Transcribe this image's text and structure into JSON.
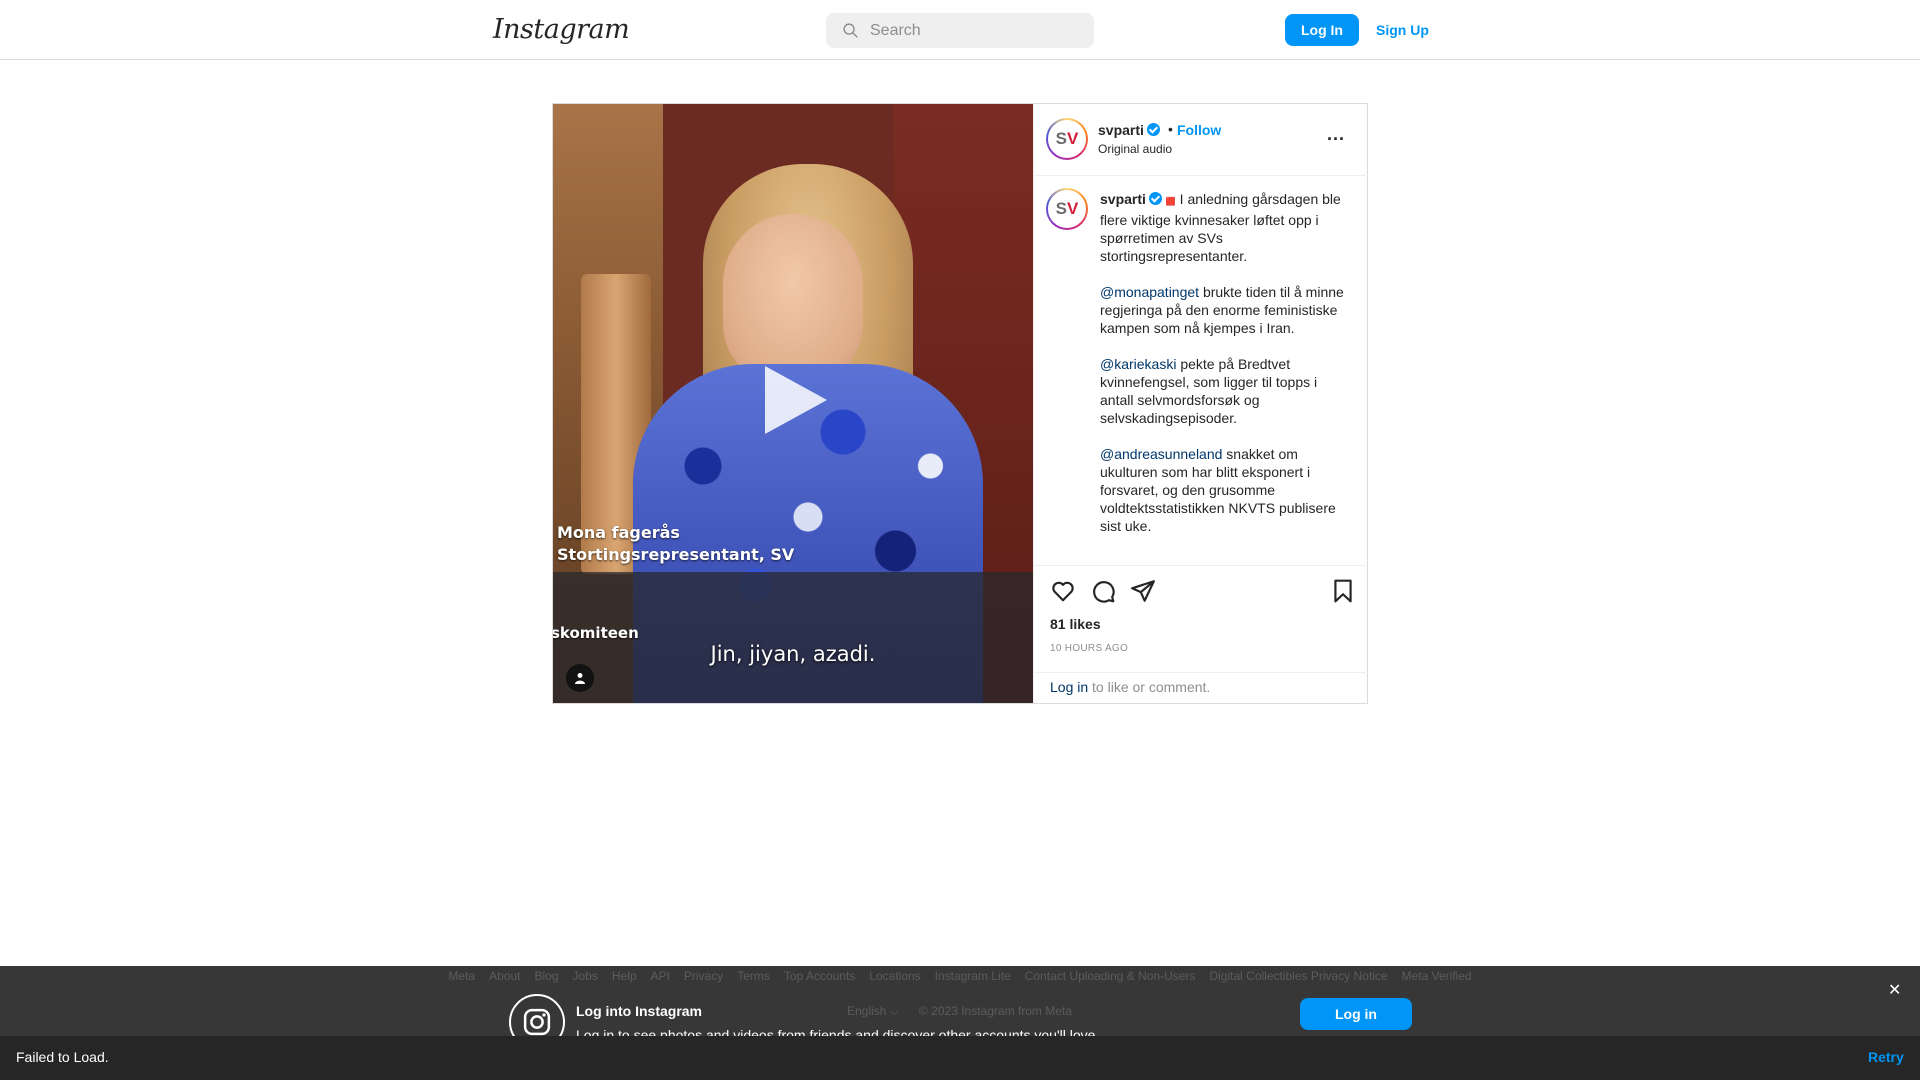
{
  "nav": {
    "logo": "Instagram",
    "search_placeholder": "Search",
    "login_label": "Log In",
    "signup_label": "Sign Up"
  },
  "post": {
    "video": {
      "name_overlay": "Mona fagerås",
      "role_overlay": "Stortingsrepresentant, SV",
      "committee_overlay": "skomiteen",
      "subtitle": "Jin, jiyan, azadi."
    },
    "header": {
      "avatar_text_s": "S",
      "avatar_text_v": "V",
      "username": "svparti",
      "separator": "•",
      "follow_label": "Follow",
      "audio_label": "Original audio",
      "more_label": "..."
    },
    "caption": {
      "username": "svparti",
      "glyph": "🟥",
      "intro": "I anledning gårsdagen ble flere viktige kvinnesaker løftet opp i spørretimen av SVs stortingsrepresentanter.",
      "p1_mention": "@monapatinget",
      "p1_text": " brukte tiden til å minne regjeringa på den enorme feministiske kampen som nå kjempes i Iran.",
      "p2_mention": "@kariekaski",
      "p2_text": " pekte på Bredtvet kvinnefengsel, som ligger til topps i antall selvmordsforsøk og selvskadingsepisoder.",
      "p3_mention": "@andreasunneland",
      "p3_text": " snakket om ukulturen som har blitt eksponert i forsvaret, og den grusomme voldtektsstatistikken NKVTS publisere sist uke."
    },
    "likes": "81 likes",
    "timestamp": "10 HOURS AGO",
    "login_link": "Log in",
    "login_suffix": " to like or comment."
  },
  "footer": {
    "links": [
      "Meta",
      "About",
      "Blog",
      "Jobs",
      "Help",
      "API",
      "Privacy",
      "Terms",
      "Top Accounts",
      "Locations",
      "Instagram Lite",
      "Contact Uploading & Non-Users",
      "Digital Collectibles Privacy Notice",
      "Meta Verified"
    ],
    "language": "English ⌵",
    "copyright": "© 2023 Instagram from Meta"
  },
  "login_banner": {
    "title": "Log into Instagram",
    "subtitle": "Log in to see photos and videos from friends and discover other accounts you'll love.",
    "login_label": "Log in",
    "close_label": "✕"
  },
  "error_bar": {
    "message": "Failed to Load.",
    "retry_label": "Retry"
  },
  "colors": {
    "accent": "#0095f6",
    "mention": "#00376b",
    "muted": "#8e8e8e",
    "error_bar": "#262626"
  },
  "icons": [
    "search-icon",
    "verified-badge-icon",
    "more-options-icon",
    "play-icon",
    "user-tag-icon",
    "heart-icon",
    "comment-icon",
    "share-icon",
    "bookmark-icon",
    "instagram-icon",
    "close-icon"
  ]
}
